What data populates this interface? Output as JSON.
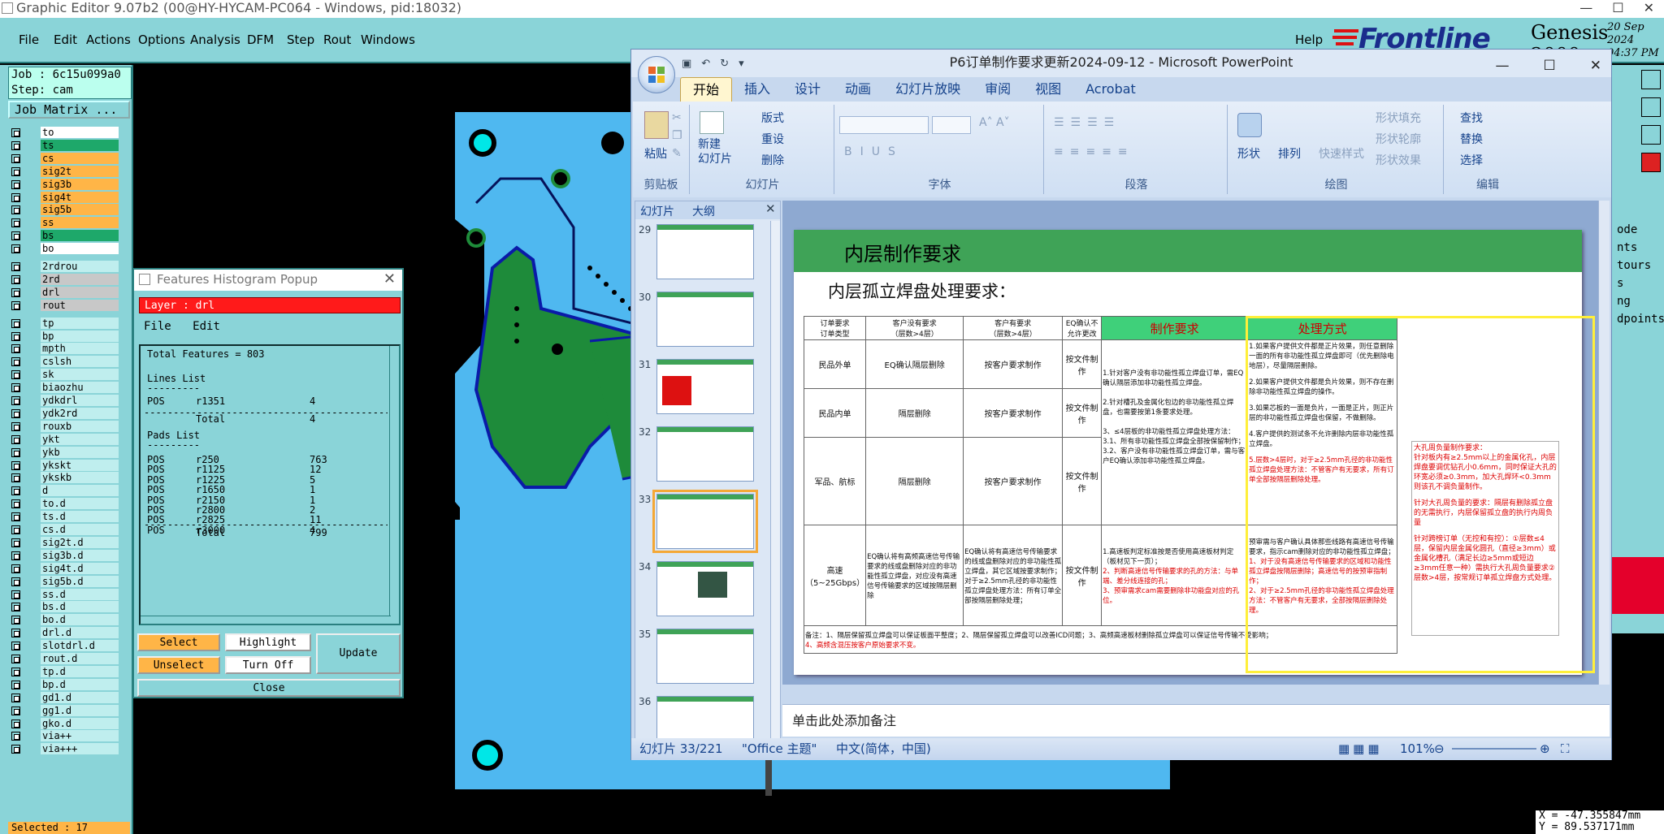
{
  "genesis": {
    "title": "Graphic Editor 9.07b2 (00@HY-HYCAM-PC064 - Windows, pid:18032)",
    "menu": [
      "File",
      "Edit",
      "Actions",
      "Options",
      "Analysis",
      "DFM",
      "Step",
      "Rout",
      "Windows"
    ],
    "help": "Help",
    "brand": "Frontline",
    "product": "Genesis 2000",
    "date": "20 Sep 2024",
    "time": "04:37 PM",
    "job": "Job : 6c15u099a0",
    "step": "Step: cam",
    "job_matrix": "Job Matrix ...",
    "layers": [
      {
        "name": "to",
        "color": "#ffffff"
      },
      {
        "name": "ts",
        "color": "#1ea86a"
      },
      {
        "name": "cs",
        "color": "#ffb547"
      },
      {
        "name": "sig2t",
        "color": "#ffb547"
      },
      {
        "name": "sig3b",
        "color": "#ffb547"
      },
      {
        "name": "sig4t",
        "color": "#ffb547"
      },
      {
        "name": "sig5b",
        "color": "#ffb547"
      },
      {
        "name": "ss",
        "color": "#ffb547"
      },
      {
        "name": "bs",
        "color": "#1ea86a"
      },
      {
        "name": "bo",
        "color": "#ffffff"
      },
      {
        "name": "2rdrou",
        "color": "#bfeeee"
      },
      {
        "name": "2rd",
        "color": "#c8c8c8"
      },
      {
        "name": "drl",
        "color": "#c8c8c8"
      },
      {
        "name": "rout",
        "color": "#c8c8c8"
      },
      {
        "name": "tp",
        "color": "#bfeeee"
      },
      {
        "name": "bp",
        "color": "#bfeeee"
      },
      {
        "name": "mpth",
        "color": "#bfeeee"
      },
      {
        "name": "cslsh",
        "color": "#bfeeee"
      },
      {
        "name": "sk",
        "color": "#bfeeee"
      },
      {
        "name": "biaozhu",
        "color": "#bfeeee"
      },
      {
        "name": "ydkdrl",
        "color": "#bfeeee"
      },
      {
        "name": "ydk2rd",
        "color": "#bfeeee"
      },
      {
        "name": "rouxb",
        "color": "#bfeeee"
      },
      {
        "name": "ykt",
        "color": "#bfeeee"
      },
      {
        "name": "ykb",
        "color": "#bfeeee"
      },
      {
        "name": "ykskt",
        "color": "#bfeeee"
      },
      {
        "name": "ykskb",
        "color": "#bfeeee"
      },
      {
        "name": "d",
        "color": "#bfeeee"
      },
      {
        "name": "to.d",
        "color": "#bfeeee"
      },
      {
        "name": "ts.d",
        "color": "#bfeeee"
      },
      {
        "name": "cs.d",
        "color": "#bfeeee"
      },
      {
        "name": "sig2t.d",
        "color": "#bfeeee"
      },
      {
        "name": "sig3b.d",
        "color": "#bfeeee"
      },
      {
        "name": "sig4t.d",
        "color": "#bfeeee"
      },
      {
        "name": "sig5b.d",
        "color": "#bfeeee"
      },
      {
        "name": "ss.d",
        "color": "#bfeeee"
      },
      {
        "name": "bs.d",
        "color": "#bfeeee"
      },
      {
        "name": "bo.d",
        "color": "#bfeeee"
      },
      {
        "name": "drl.d",
        "color": "#bfeeee"
      },
      {
        "name": "slotdrl.d",
        "color": "#bfeeee"
      },
      {
        "name": "rout.d",
        "color": "#bfeeee"
      },
      {
        "name": "tp.d",
        "color": "#bfeeee"
      },
      {
        "name": "bp.d",
        "color": "#bfeeee"
      },
      {
        "name": "gd1.d",
        "color": "#bfeeee"
      },
      {
        "name": "gg1.d",
        "color": "#bfeeee"
      },
      {
        "name": "gko.d",
        "color": "#bfeeee"
      },
      {
        "name": "via++",
        "color": "#bfeeee"
      },
      {
        "name": "via+++",
        "color": "#bfeeee"
      }
    ],
    "selected": "Selected : 17",
    "coords": {
      "x": "X = -47.355847mm",
      "y": "Y = 89.537171mm"
    },
    "right_panel": [
      "ode",
      "nts",
      "tours",
      "s",
      "ng",
      "dpoints"
    ]
  },
  "histogram": {
    "title": "Features Histogram Popup",
    "layer": "Layer : drl",
    "menu": [
      "File",
      "Edit"
    ],
    "total_features": "Total Features = 803",
    "lines_header": "Lines List",
    "lines": [
      {
        "type": "POS",
        "sym": "r1351",
        "count": "4"
      }
    ],
    "lines_total": "4",
    "pads_header": "Pads List",
    "pads": [
      {
        "type": "POS",
        "sym": "r250",
        "count": "763"
      },
      {
        "type": "POS",
        "sym": "r1125",
        "count": "12"
      },
      {
        "type": "POS",
        "sym": "r1225",
        "count": "5"
      },
      {
        "type": "POS",
        "sym": "r1650",
        "count": "1"
      },
      {
        "type": "POS",
        "sym": "r2150",
        "count": "1"
      },
      {
        "type": "POS",
        "sym": "r2800",
        "count": "2"
      },
      {
        "type": "POS",
        "sym": "r2825",
        "count": "11"
      },
      {
        "type": "POS",
        "sym": "r3000",
        "count": "4"
      }
    ],
    "pads_total": "799",
    "total_label": "Total",
    "buttons": {
      "select": "Select",
      "highlight": "Highlight",
      "unselect": "Unselect",
      "turnoff": "Turn Off",
      "update": "Update",
      "close": "Close"
    }
  },
  "ppt": {
    "title": "P6订单制作要求更新2024-09-12 - Microsoft PowerPoint",
    "tabs": [
      "开始",
      "插入",
      "设计",
      "动画",
      "幻灯片放映",
      "审阅",
      "视图",
      "Acrobat"
    ],
    "groups": {
      "clipboard": "剪贴板",
      "slides": "幻灯片",
      "font": "字体",
      "paragraph": "段落",
      "drawing": "绘图",
      "editing": "编辑"
    },
    "btn": {
      "paste": "粘贴",
      "new_slide": "新建\n幻灯片",
      "layout": "版式",
      "reset": "重设",
      "delete": "删除",
      "shape": "形状",
      "arrange": "排列",
      "quick_style": "快速样式",
      "fill": "形状填充",
      "outline": "形状轮廓",
      "effect": "形状效果",
      "find": "查找",
      "replace": "替换",
      "select": "选择"
    },
    "pane_tabs": [
      "幻灯片",
      "大纲"
    ],
    "thumb_nums": [
      "29",
      "30",
      "31",
      "32",
      "33",
      "34",
      "35",
      "36"
    ],
    "notes": "单击此处添加备注",
    "status": {
      "slide": "幻灯片 33/221",
      "theme": "\"Office 主题\"",
      "lang": "中文(简体，中国)",
      "zoom": "101%"
    },
    "slide": {
      "header": "内层制作要求",
      "subtitle": "内层孤立焊盘处理要求：",
      "col_headers": [
        "订单要求\n订单类型",
        "客户没有要求\n（层数>4层）",
        "客户有要求\n（层数>4层）",
        "EQ确认不允许更改",
        "制作要求",
        "处理方式"
      ],
      "rows": [
        {
          "type": "民品外单",
          "c1": "EQ确认隔层删除",
          "c2": "按客户要求制作",
          "c3": "按文件制作"
        },
        {
          "type": "民品内单",
          "c1": "隔层删除",
          "c2": "按客户要求制作",
          "c3": "按文件制作"
        },
        {
          "type": "军品、航标",
          "c1": "隔层删除",
          "c2": "按客户要求制作",
          "c3": "按文件制作"
        },
        {
          "type": "高速\n（5~25Gbps）",
          "c1": "EQ确认将有高频高速信号传输要求的线或盘删除对应的非功能性孤立焊盘，对应没有高速信号传输要求的区域按隔层删除",
          "c2": "EQ确认将有高速信号传输要求的线或盘删除对应的非功能性孤立焊盘，其它区域按要求制作；对于≥2.5mm孔径的非功能性孤立焊盘处理方法：所有订单全部按隔层删除处理；",
          "c3": "按文件制作"
        }
      ],
      "req_1": "1.针对客户没有非功能性孤立焊盘订单，需EQ确认隔层添加非功能性孤立焊盘。",
      "req_2": "2.针对槽孔及金属化包边的非功能性孤立焊盘，也需要按第1条要求处理。",
      "req_3": "3、≤4层板的非功能性孤立焊盘处理方法：3.1、所有非功能性孤立焊盘全部按保留制作；　　3.2、客户没有非功能性孤立焊盘订单，需与客户EQ确认添加非功能性孤立焊盘。",
      "req_4": "1.高速板判定标准按是否使用高速板材判定（板材见下一页）；",
      "req_5": "2、判断高速信号传输要求的孔的方法：与单端、差分线连接的孔；",
      "req_6": "3、预审需求cam需要删除非功能盘对应的孔位。",
      "proc_1": "1.如果客户提供文件都是正片效果，则任意删除一面的所有非功能性孤立焊盘即可（优先删除电地层），尽量隔层删除。",
      "proc_2": "2.如果客户提供文件都是负片效果，则不存在删除非功能性孤立焊盘的操作。",
      "proc_3": "3.如果芯板的一面是负片，一面是正片，则正片层的非功能性孤立焊盘也保留，不做删除。",
      "proc_4": "4.客户提供的测试条不允许删除内层非功能性孤立焊盘。",
      "proc_5": "5.层数>4层时，对于≥2.5mm孔径的非功能性孤立焊盘处理方法：不管客户有无要求，所有订单全部按隔层删除处理。",
      "proc_6": "预审需与客户确认具体那些线路有高速信号传输要求，指示cam删除对应的非功能性孤立焊盘；",
      "proc_7": "1、对于没有高速信号传输要求的区域和功能性孤立焊盘按隔层删除；高速信号的按预审指制作；",
      "proc_8": "2、对于≥2.5mm孔径的非功能性孤立焊盘处理方法：不管客户有无要求，全部按隔层删除处理。",
      "side_1": "大孔周负量制作要求：",
      "side_2": "针对板内有≥2.5mm以上的金属化孔，内层焊盘要调优钻孔小0.6mm，同时保证大孔的环宽必须≥0.3mm，加大孔焊环<0.3mm则该孔不调负量制作。",
      "side_3": "针对大孔周负量的要求：隔层有删除孤立盘的无需执行，内层保留孤立盘的执行内周负量",
      "side_4": "针对跨榜订单（无控和有控）：①层数≤4层，保留内层金属化圆孔（直径≥3mm）或金属化槽孔（满足长边≥5mm或短边≥3mm任意一种）需执行大孔周负量要求②层数>4层，按常规订单孤立焊盘方式处理。",
      "note_1": "备注：1、隔层保留孤立焊盘可以保证板面平整度；2、隔层保留孤立焊盘可以改善ICD问题；3、高频高速板材删除孤立焊盘可以保证信号传输不受影响；",
      "note_2": "4、高频含混压按客户原始要求不变。"
    }
  }
}
